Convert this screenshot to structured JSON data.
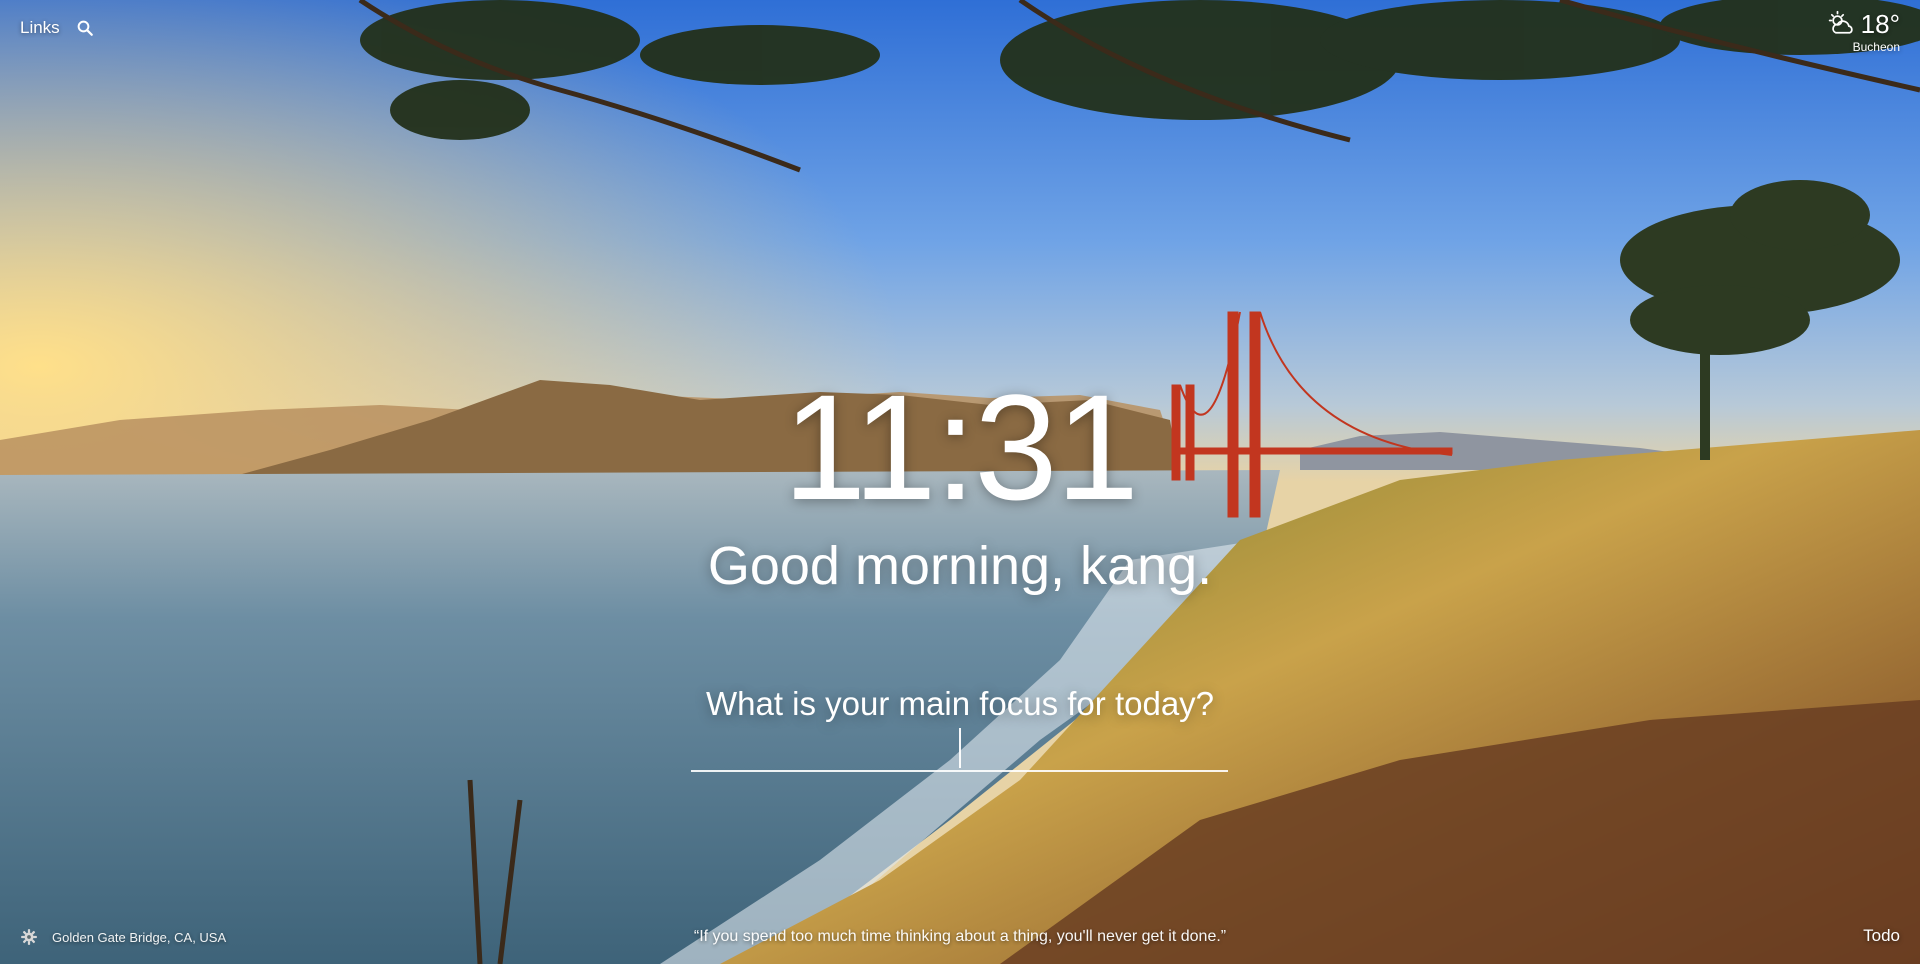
{
  "top_left": {
    "links_label": "Links",
    "search_icon": "search-icon"
  },
  "weather": {
    "temperature": "18°",
    "location": "Bucheon",
    "icon": "partly-cloudy-icon"
  },
  "main": {
    "clock": "11:31",
    "greeting": "Good morning, kang.",
    "focus_question": "What is your main focus for today?",
    "focus_value": ""
  },
  "bottom": {
    "settings_icon": "gear-icon",
    "photo_location": "Golden Gate Bridge, CA, USA",
    "quote": "“If you spend too much time thinking about a thing, you'll never get it done.”",
    "todo_label": "Todo"
  },
  "colors": {
    "sky_top": "#2f6fd6",
    "sky_glow": "#ffd27a",
    "bridge": "#c2361f",
    "sea": "#5a7f98"
  }
}
